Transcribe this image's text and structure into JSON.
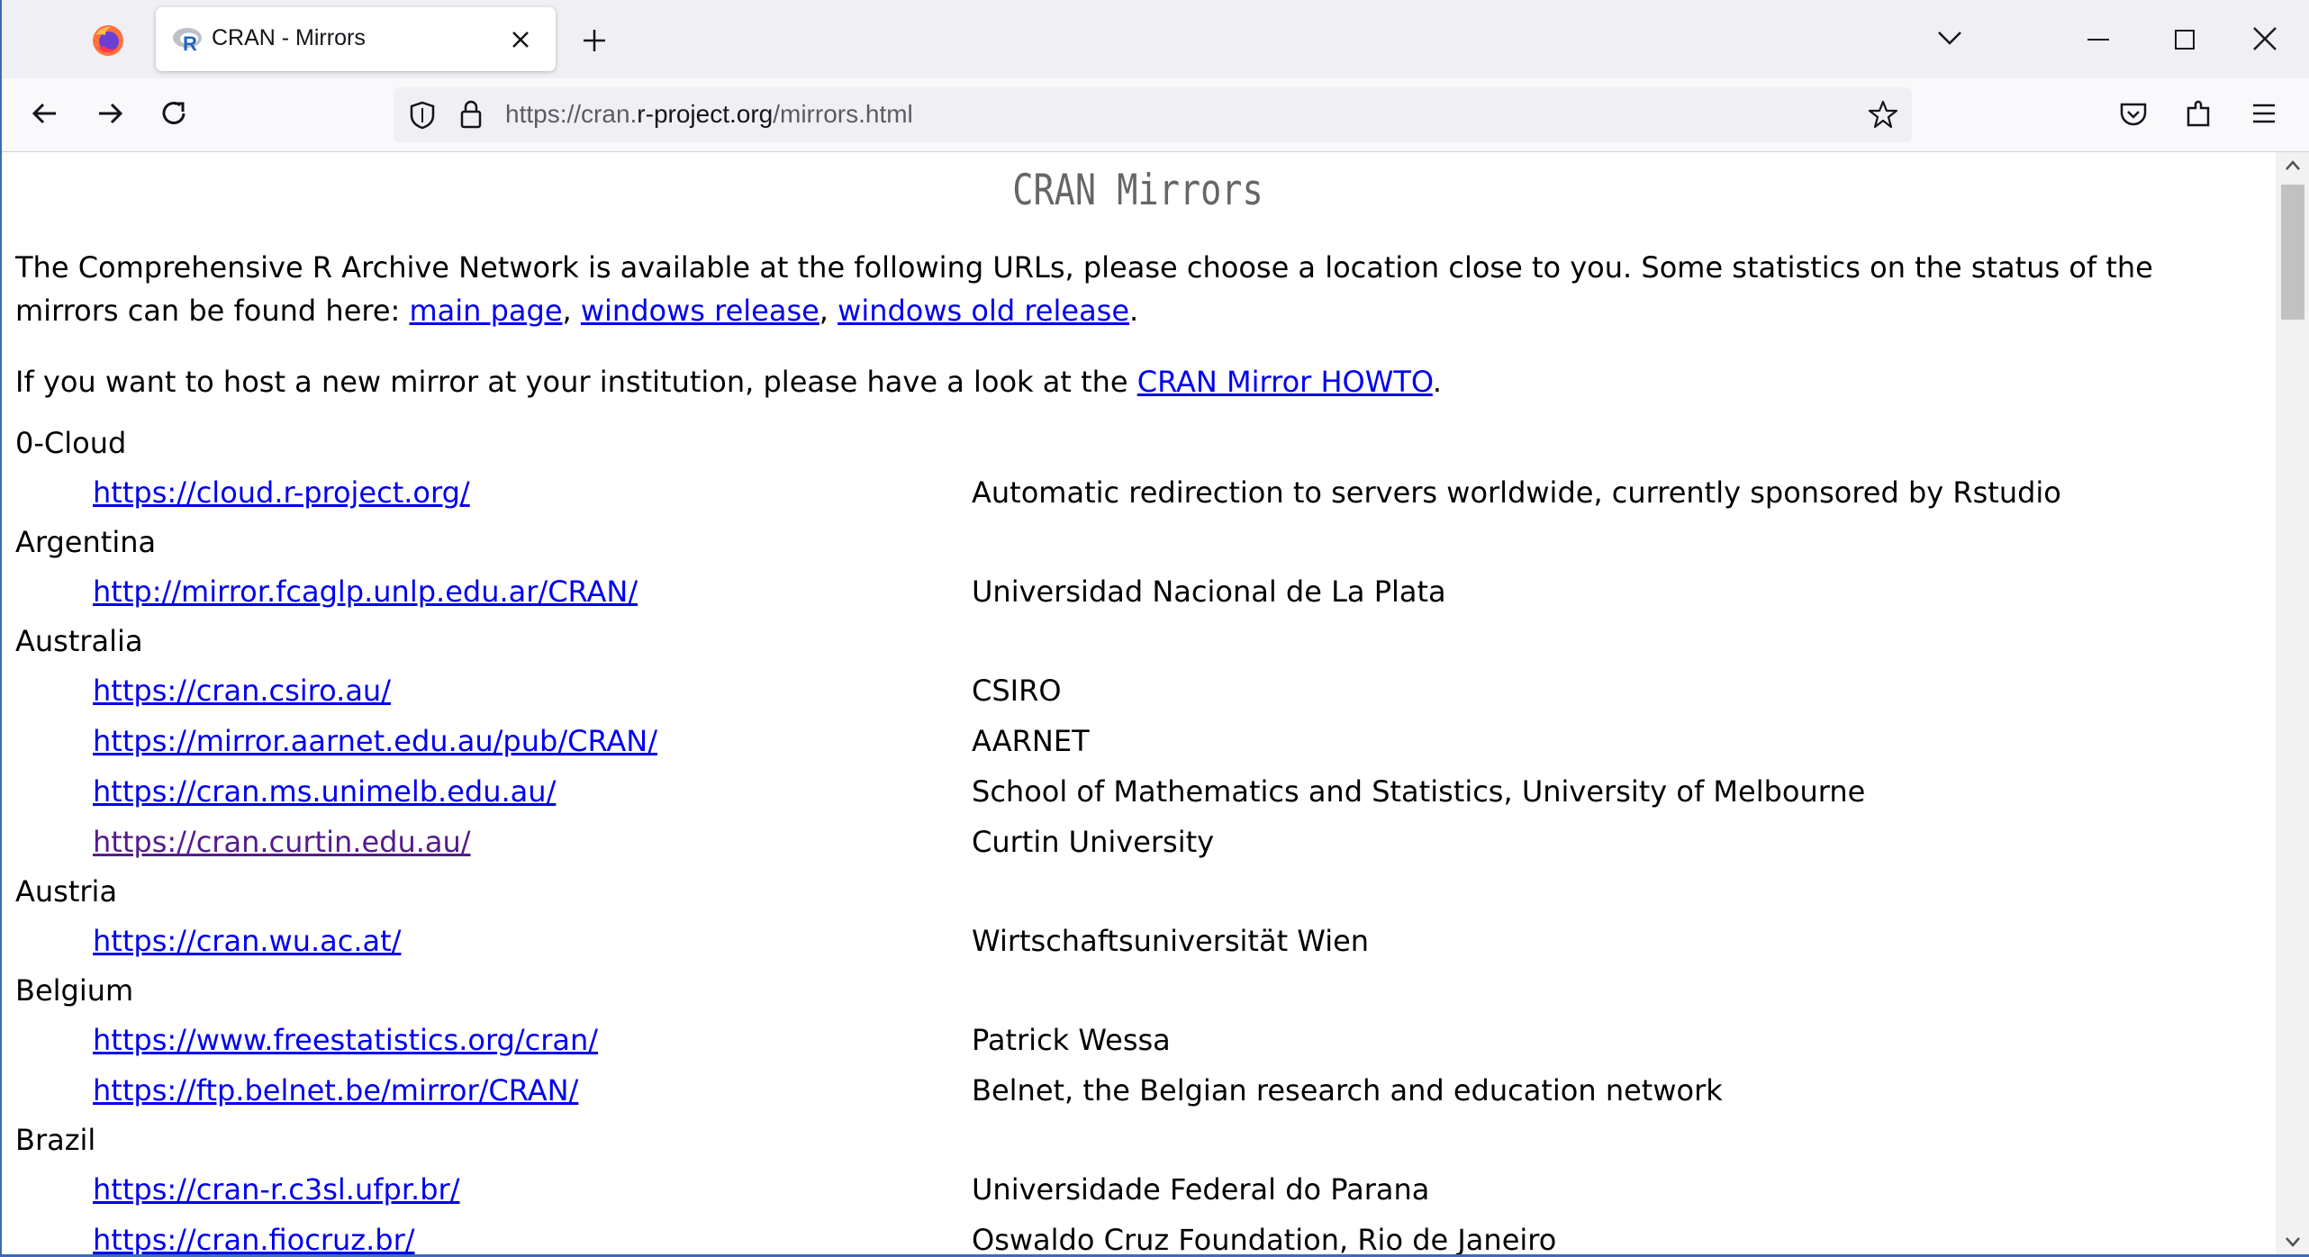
{
  "browser": {
    "tab_title": "CRAN - Mirrors",
    "url_prefix": "https://cran.",
    "url_domain": "r-project.org",
    "url_path": "/mirrors.html"
  },
  "page": {
    "title": "CRAN Mirrors",
    "intro_text": "The Comprehensive R Archive Network is available at the following URLs, please choose a location close to you. Some statistics on the status of the mirrors can be found here: ",
    "stat_links": [
      "main page",
      "windows release",
      "windows old release"
    ],
    "host_text": "If you want to host a new mirror at your institution, please have a look at the ",
    "howto_link": "CRAN Mirror HOWTO"
  },
  "mirrors": [
    {
      "country": "0-Cloud",
      "entries": [
        {
          "url": "https://cloud.r-project.org/",
          "host": "Automatic redirection to servers worldwide, currently sponsored by Rstudio",
          "visited": false
        }
      ]
    },
    {
      "country": "Argentina",
      "entries": [
        {
          "url": "http://mirror.fcaglp.unlp.edu.ar/CRAN/",
          "host": "Universidad Nacional de La Plata",
          "visited": false
        }
      ]
    },
    {
      "country": "Australia",
      "entries": [
        {
          "url": "https://cran.csiro.au/",
          "host": "CSIRO",
          "visited": false
        },
        {
          "url": "https://mirror.aarnet.edu.au/pub/CRAN/",
          "host": "AARNET",
          "visited": false
        },
        {
          "url": "https://cran.ms.unimelb.edu.au/",
          "host": "School of Mathematics and Statistics, University of Melbourne",
          "visited": false
        },
        {
          "url": "https://cran.curtin.edu.au/",
          "host": "Curtin University",
          "visited": true
        }
      ]
    },
    {
      "country": "Austria",
      "entries": [
        {
          "url": "https://cran.wu.ac.at/",
          "host": "Wirtschaftsuniversität Wien",
          "visited": false
        }
      ]
    },
    {
      "country": "Belgium",
      "entries": [
        {
          "url": "https://www.freestatistics.org/cran/",
          "host": "Patrick Wessa",
          "visited": false
        },
        {
          "url": "https://ftp.belnet.be/mirror/CRAN/",
          "host": "Belnet, the Belgian research and education network",
          "visited": false
        }
      ]
    },
    {
      "country": "Brazil",
      "entries": [
        {
          "url": "https://cran-r.c3sl.ufpr.br/",
          "host": "Universidade Federal do Parana",
          "visited": false
        },
        {
          "url": "https://cran.fiocruz.br/",
          "host": "Oswaldo Cruz Foundation, Rio de Janeiro",
          "visited": false
        }
      ]
    }
  ],
  "icons": {
    "firefox": "firefox-logo-icon",
    "favicon": "r-logo-icon",
    "close": "close-icon",
    "new_tab": "plus-icon",
    "tab_list": "chevron-down-icon",
    "back": "back-arrow-icon",
    "forward": "forward-arrow-icon",
    "reload": "reload-icon",
    "shield": "shield-icon",
    "lock": "lock-icon",
    "bookmark": "star-icon",
    "pocket": "pocket-icon",
    "extensions": "puzzle-icon",
    "menu": "hamburger-menu-icon"
  },
  "colors": {
    "link": "#0000ee",
    "visited_link": "#551a8b",
    "title": "#666666",
    "tabstrip": "#f0f0f4",
    "urlbar": "#f0f0f4"
  }
}
